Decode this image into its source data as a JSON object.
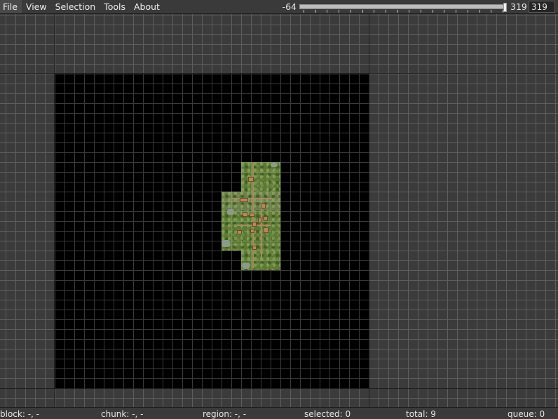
{
  "menu": {
    "items": [
      "File",
      "View",
      "Selection",
      "Tools",
      "About"
    ]
  },
  "y_range": {
    "min_label": "-64",
    "max_label": "319",
    "input_value": "319",
    "slider_level": 1.0,
    "tick_count": 18
  },
  "status": {
    "block": "block: -, -",
    "chunk": "chunk: -, -",
    "region": "region: -, -",
    "selected": "selected: 0",
    "total": "total: 9",
    "queue": "queue: 0"
  },
  "colors": {
    "background": "#2b2b2b",
    "grid_line": "#5e5e5e",
    "region_fill": "#000000",
    "terrain_green": "#5a7a34",
    "building": "#b8885a"
  }
}
